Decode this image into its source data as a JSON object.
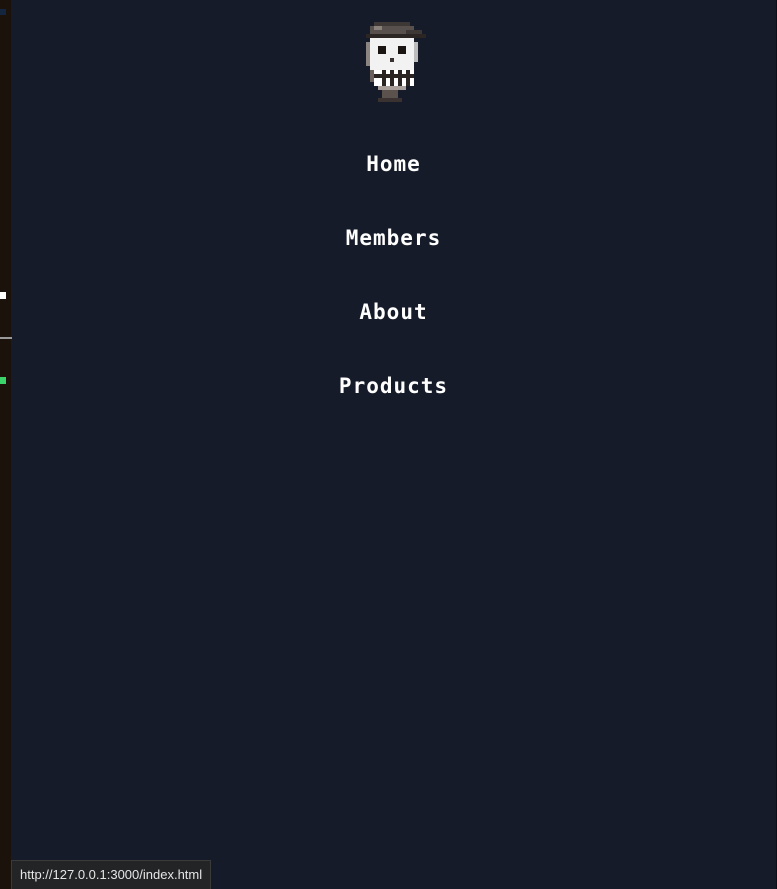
{
  "nav": {
    "logo_icon": "pixel-skull-with-cap-icon",
    "items": [
      {
        "label": "Home"
      },
      {
        "label": "Members"
      },
      {
        "label": "About"
      },
      {
        "label": "Products"
      }
    ]
  },
  "status_bar": {
    "url": "http://127.0.0.1:3000/index.html"
  },
  "colors": {
    "background": "#151b28",
    "text": "#ffffff",
    "left_strip": "#1b120b"
  }
}
